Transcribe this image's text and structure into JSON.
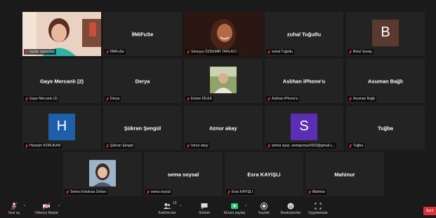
{
  "participants": [
    {
      "id": "p1",
      "name": "suzan cavuşdak",
      "display": "video"
    },
    {
      "id": "p2",
      "name": "İlMiFuSe",
      "center": "İlMiFuSe",
      "display": "name"
    },
    {
      "id": "p3",
      "name": "Süreyya ÖZDEMİR TARLACI",
      "display": "video",
      "active": true
    },
    {
      "id": "p4",
      "name": "zuhal Tuğutlu",
      "center": "zuhal Tuğutlu",
      "display": "name"
    },
    {
      "id": "p5",
      "name": "Betul Savaş",
      "initial": "B",
      "avatar_color": "#5a3a2f",
      "display": "avatar"
    },
    {
      "id": "p6",
      "name": "Gaye Mercanlı (2)",
      "center": "Gaye Mercanlı (2)",
      "display": "name"
    },
    {
      "id": "p7",
      "name": "Derya",
      "center": "Derya",
      "display": "name"
    },
    {
      "id": "p8",
      "name": "Emine DİLEK",
      "display": "photo"
    },
    {
      "id": "p9",
      "name": "Aslıhan iPhone'u",
      "center": "Aslıhan iPhone'u",
      "display": "name"
    },
    {
      "id": "p10",
      "name": "Asuman Bağlı",
      "center": "Asuman Bağlı",
      "display": "name"
    },
    {
      "id": "p11",
      "name": "Hüseyin KORUKAN",
      "initial": "H",
      "avatar_color": "#1d5fa8",
      "display": "avatar"
    },
    {
      "id": "p12",
      "name": "Şükran Şengül",
      "center": "Şükran Şengül",
      "display": "name"
    },
    {
      "id": "p13",
      "name": "öznur akay",
      "center": "öznur akay",
      "display": "name"
    },
    {
      "id": "p14",
      "name": "selma ayaz, semapenye0910@gmail.c...",
      "initial": "S",
      "avatar_color": "#5b2fb5",
      "display": "avatar"
    },
    {
      "id": "p15",
      "name": "Tuğba",
      "center": "Tuğba",
      "display": "name"
    },
    {
      "id": "p16",
      "name": "Semra Kolukısa Ünlüer",
      "display": "photo2"
    },
    {
      "id": "p17",
      "name": "sema soysal",
      "center": "sema soysal",
      "display": "name"
    },
    {
      "id": "p18",
      "name": "Esra KAYIŞLI",
      "center": "Esra KAYIŞLI",
      "display": "name"
    },
    {
      "id": "p19",
      "name": "Mahinur",
      "center": "Mahinur",
      "display": "name"
    }
  ],
  "toolbar": {
    "unmute": "Sesi aç",
    "start_video": "Videoyu Başlat",
    "participants": "Katılımcılar",
    "participant_count": "19",
    "chat": "Sohbet",
    "share": "Ekranı paylaş",
    "record": "Kaydet",
    "reactions": "Reaksiyonlar",
    "apps": "Uygulamalar",
    "end": "Ayrıl"
  },
  "colors": {
    "active_border": "#e6e44a",
    "share_green": "#2ecc71",
    "end_red": "#d9333a"
  }
}
